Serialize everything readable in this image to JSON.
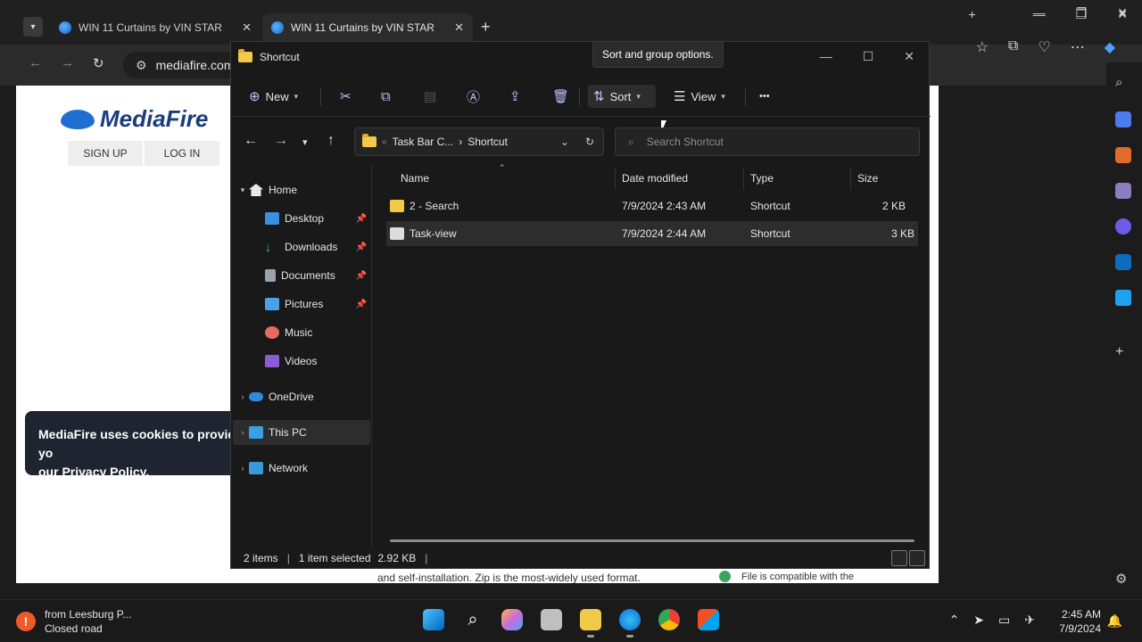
{
  "browser": {
    "tabs": [
      {
        "label": "WIN 11 Curtains by VIN STAR",
        "close": "✕"
      },
      {
        "label": "WIN 11 Curtains by VIN STAR",
        "close": "✕"
      }
    ],
    "url": "mediafire.com",
    "page": {
      "logo_text": "MediaFire",
      "signup_label": "SIGN UP",
      "login_label": "LOG IN",
      "cookie_line1": "MediaFire uses cookies to provide yo",
      "cookie_line2_prefix": "our ",
      "cookie_link": "Privacy Policy",
      "cookie_line2_suffix": ".",
      "bottom_text": "and self-installation. Zip is the most-widely used format.",
      "compat_text": "File is compatible with the"
    }
  },
  "explorer": {
    "title": "Shortcut",
    "tooltip": "Sort and group options.",
    "commands": {
      "new_label": "New",
      "sort_label": "Sort",
      "view_label": "View",
      "more_label": "•••"
    },
    "address": {
      "crumb1": "Task Bar C...",
      "crumb2": "Shortcut",
      "overflow": "«"
    },
    "search_placeholder": "Search Shortcut",
    "nav": [
      {
        "label": "Home"
      },
      {
        "label": "Desktop"
      },
      {
        "label": "Downloads"
      },
      {
        "label": "Documents"
      },
      {
        "label": "Pictures"
      },
      {
        "label": "Music"
      },
      {
        "label": "Videos"
      },
      {
        "label": "OneDrive"
      },
      {
        "label": "This PC"
      },
      {
        "label": "Network"
      }
    ],
    "columns": {
      "name": "Name",
      "date": "Date modified",
      "type": "Type",
      "size": "Size"
    },
    "files": [
      {
        "name": "2 - Search",
        "date": "7/9/2024 2:43 AM",
        "type": "Shortcut",
        "size": "2 KB"
      },
      {
        "name": "Task-view",
        "date": "7/9/2024 2:44 AM",
        "type": "Shortcut",
        "size": "3 KB"
      }
    ],
    "status": {
      "items": "2 items",
      "selected": "1 item selected",
      "selected_size": "2.92 KB"
    }
  },
  "taskbar": {
    "weather_line1": "from Leesburg P...",
    "weather_line2": "Closed road",
    "time": "2:45 AM",
    "date": "7/9/2024"
  },
  "colors": {
    "accent": "#0067c0",
    "folder": "#f3c94a",
    "bg_dark": "#191919"
  }
}
